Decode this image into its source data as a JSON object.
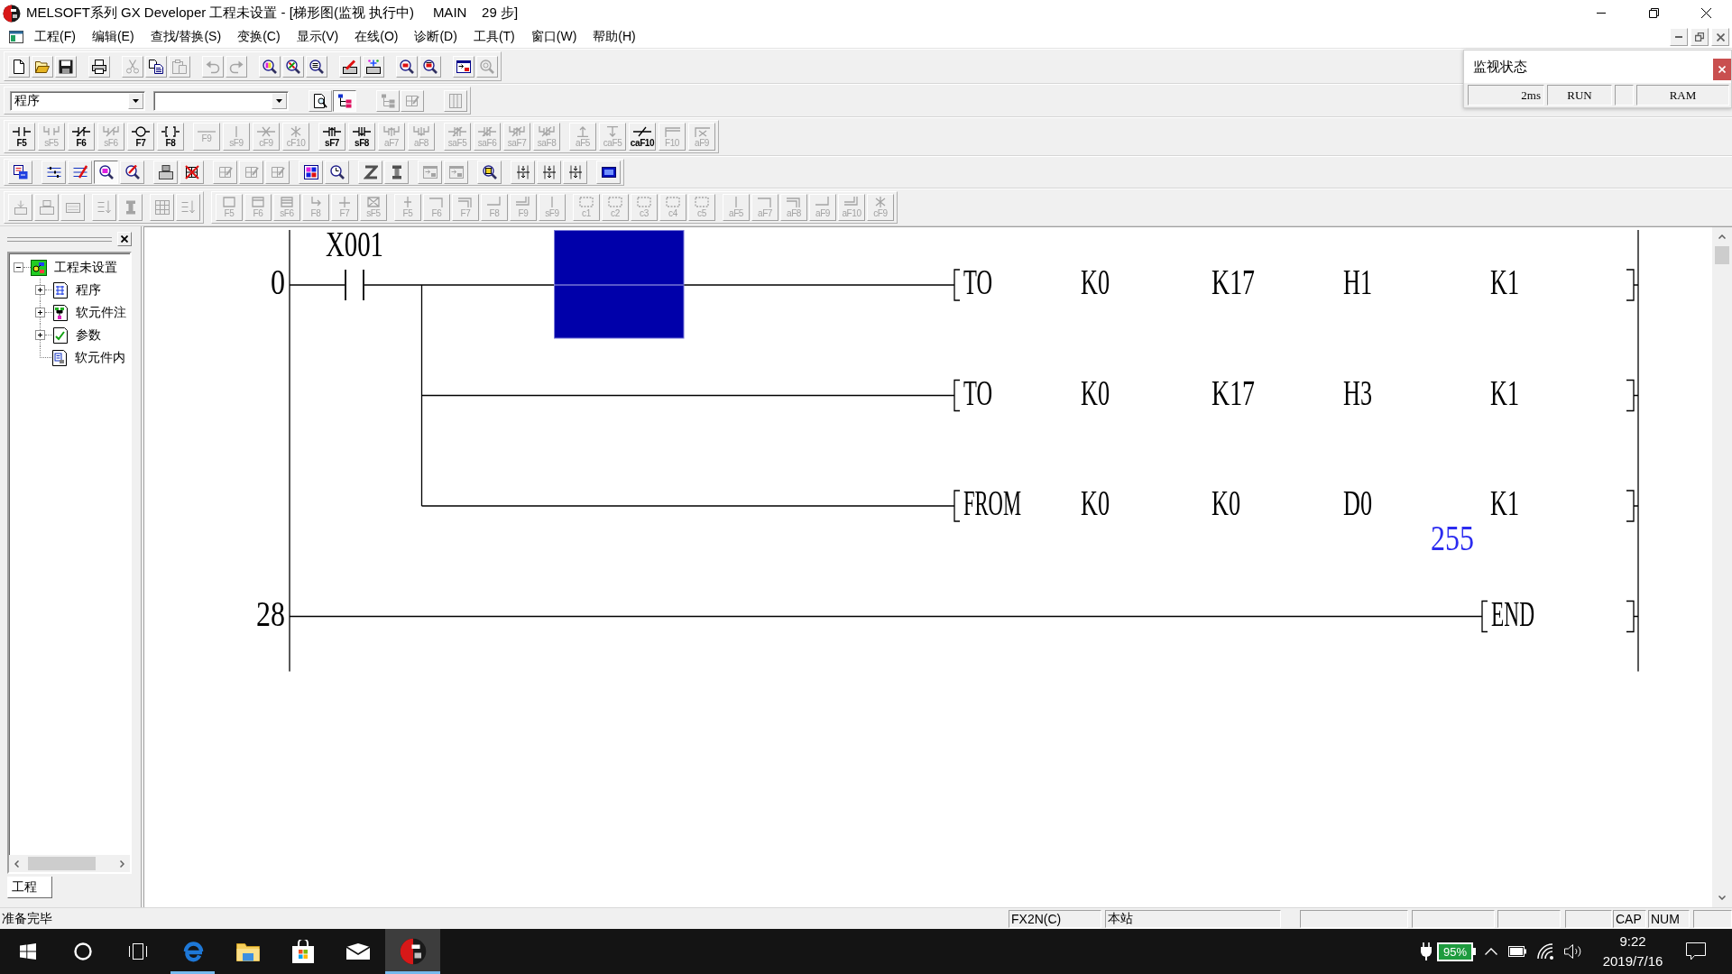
{
  "window": {
    "title": "MELSOFT系列 GX Developer 工程未设置 - [梯形图(监视 执行中)     MAIN    29 步]"
  },
  "menu": [
    "工程(F)",
    "编辑(E)",
    "查找/替换(S)",
    "变换(C)",
    "显示(V)",
    "在线(O)",
    "诊断(D)",
    "工具(T)",
    "窗口(W)",
    "帮助(H)"
  ],
  "toolbar_rows": [
    {
      "strips": [
        [
          [
            {
              "kind": "new",
              "disabled": false
            },
            {
              "kind": "open",
              "disabled": false
            },
            {
              "kind": "save",
              "disabled": false
            }
          ],
          [
            {
              "kind": "print",
              "disabled": false
            }
          ],
          [
            {
              "kind": "cut",
              "disabled": true
            },
            {
              "kind": "copy",
              "disabled": false
            },
            {
              "kind": "paste",
              "disabled": true
            }
          ],
          [
            {
              "kind": "undo",
              "disabled": true
            },
            {
              "kind": "redo",
              "disabled": true
            }
          ],
          [
            {
              "kind": "find-device",
              "disabled": false
            },
            {
              "kind": "find-instruction",
              "disabled": false
            },
            {
              "kind": "find-step",
              "disabled": false
            }
          ],
          [
            {
              "kind": "write",
              "disabled": false
            },
            {
              "kind": "read",
              "disabled": false
            }
          ],
          [
            {
              "kind": "find-box",
              "disabled": false
            },
            {
              "kind": "find-box-arrow",
              "disabled": false
            }
          ],
          [
            {
              "kind": "window-arrow",
              "disabled": false
            },
            {
              "kind": "find-gear",
              "disabled": true
            }
          ]
        ]
      ]
    },
    {
      "program_select": "程序",
      "strips": [
        [
          [
            {
              "kind": "page-magnifier",
              "disabled": false,
              "pressed": false
            },
            {
              "kind": "hierarchy",
              "disabled": false,
              "pressed": true
            }
          ],
          [
            {
              "kind": "hierarchy",
              "disabled": true,
              "pressed": false
            },
            {
              "kind": "grid-pencil",
              "disabled": true,
              "pressed": false
            }
          ],
          [
            {
              "kind": "columns",
              "disabled": true,
              "pressed": false
            }
          ]
        ]
      ]
    },
    {
      "strips": [
        [
          [
            {
              "kind": "contact",
              "key": "F5",
              "disabled": false
            },
            {
              "kind": "parallel-contact",
              "key": "sF5",
              "disabled": true
            },
            {
              "kind": "closed-contact",
              "key": "F6",
              "disabled": false
            },
            {
              "kind": "parallel-closed-contact",
              "key": "sF6",
              "disabled": true
            },
            {
              "kind": "coil",
              "key": "F7",
              "disabled": false
            },
            {
              "kind": "brace",
              "key": "F8",
              "disabled": false
            }
          ],
          [
            {
              "kind": "hline",
              "key": "F9",
              "disabled": true
            },
            {
              "kind": "vline",
              "key": "sF9",
              "disabled": true
            },
            {
              "kind": "hline-delete",
              "key": "cF9",
              "disabled": true
            },
            {
              "kind": "vline-delete",
              "key": "cF10",
              "disabled": true
            }
          ],
          [
            {
              "kind": "rising-contact",
              "key": "sF7",
              "disabled": false
            },
            {
              "kind": "falling-contact",
              "key": "sF8",
              "disabled": false
            },
            {
              "kind": "parallel-rising-contact",
              "key": "aF7",
              "disabled": true
            },
            {
              "kind": "parallel-falling-contact",
              "key": "aF8",
              "disabled": true
            }
          ],
          [
            {
              "kind": "rising-closed-contact",
              "key": "saF5",
              "disabled": true
            },
            {
              "kind": "falling-closed-contact",
              "key": "saF6",
              "disabled": true
            },
            {
              "kind": "parallel-rising-closed-contact",
              "key": "saF7",
              "disabled": true
            },
            {
              "kind": "parallel-falling-closed-contact",
              "key": "saF8",
              "disabled": true
            }
          ],
          [
            {
              "kind": "arrow-up",
              "key": "aF5",
              "disabled": true
            },
            {
              "kind": "arrow-down",
              "key": "caF5",
              "disabled": true
            },
            {
              "kind": "invert",
              "key": "caF10",
              "disabled": false
            },
            {
              "kind": "line-draw",
              "key": "F10",
              "disabled": true
            },
            {
              "kind": "line-delete",
              "key": "aF9",
              "disabled": true
            }
          ]
        ]
      ]
    },
    {
      "strips": [
        [
          [
            {
              "kind": "convert",
              "disabled": false,
              "pressed": false
            }
          ],
          [
            {
              "kind": "list",
              "disabled": false,
              "pressed": false
            },
            {
              "kind": "list-pencil",
              "disabled": false,
              "pressed": false
            },
            {
              "kind": "find-pink",
              "disabled": false,
              "pressed": true
            },
            {
              "kind": "find-pencil",
              "disabled": false,
              "pressed": false
            }
          ],
          [
            {
              "kind": "stamp",
              "disabled": false,
              "pressed": false
            },
            {
              "kind": "crossed-grid",
              "disabled": false,
              "pressed": false
            }
          ],
          [
            {
              "kind": "grid-pencil",
              "disabled": true,
              "pressed": false
            },
            {
              "kind": "grid-pencil",
              "disabled": true,
              "pressed": false
            },
            {
              "kind": "grid-pencil",
              "disabled": true,
              "pressed": false
            }
          ],
          [
            {
              "kind": "color-grid",
              "disabled": false,
              "pressed": false
            },
            {
              "kind": "find-clock",
              "disabled": false,
              "pressed": false
            }
          ],
          [
            {
              "kind": "z-shape",
              "disabled": false,
              "pressed": false
            },
            {
              "kind": "bar",
              "disabled": false,
              "pressed": false
            }
          ],
          [
            {
              "kind": "window-arrow",
              "disabled": true,
              "pressed": false
            },
            {
              "kind": "window-arrow",
              "disabled": true,
              "pressed": false
            }
          ],
          [
            {
              "kind": "find-yellow",
              "disabled": false,
              "pressed": false
            }
          ],
          [
            {
              "kind": "spacing",
              "disabled": false,
              "pressed": false
            },
            {
              "kind": "spacing",
              "disabled": false,
              "pressed": false
            },
            {
              "kind": "spacing",
              "disabled": false,
              "pressed": false
            }
          ],
          [
            {
              "kind": "monitor",
              "disabled": false,
              "pressed": false
            }
          ]
        ]
      ]
    },
    {
      "strips": [
        [
          [
            {
              "kind": "tray-arrow",
              "disabled": true
            },
            {
              "kind": "stamp",
              "disabled": true
            },
            {
              "kind": "label-box",
              "disabled": true
            }
          ],
          [
            {
              "kind": "sort",
              "disabled": true
            },
            {
              "kind": "bar",
              "disabled": true
            }
          ],
          [
            {
              "kind": "grid",
              "disabled": true
            },
            {
              "kind": "sort",
              "disabled": true
            }
          ]
        ],
        [
          [
            {
              "kind": "step",
              "key": "F5",
              "disabled": true
            },
            {
              "kind": "initial-step",
              "key": "F6",
              "disabled": true
            },
            {
              "kind": "block-step",
              "key": "sF6",
              "disabled": true
            },
            {
              "kind": "jump",
              "key": "F8",
              "disabled": true
            },
            {
              "kind": "transition",
              "key": "F7",
              "disabled": true
            },
            {
              "kind": "end-step",
              "key": "sF5",
              "disabled": true
            }
          ],
          [
            {
              "kind": "cross",
              "key": "F5",
              "disabled": true
            },
            {
              "kind": "branch-open",
              "key": "F6",
              "disabled": true
            },
            {
              "kind": "double-branch-open",
              "key": "F7",
              "disabled": true
            },
            {
              "kind": "branch-close",
              "key": "F8",
              "disabled": true
            },
            {
              "kind": "double-branch-close",
              "key": "F9",
              "disabled": true
            },
            {
              "kind": "vline",
              "key": "sF9",
              "disabled": true
            }
          ],
          [
            {
              "kind": "dashed-box",
              "key": "c1",
              "disabled": true
            },
            {
              "kind": "dashed-box",
              "key": "c2",
              "disabled": true
            },
            {
              "kind": "dashed-box",
              "key": "c3",
              "disabled": true
            },
            {
              "kind": "dashed-box",
              "key": "c4",
              "disabled": true
            },
            {
              "kind": "dashed-box",
              "key": "c5",
              "disabled": true
            }
          ],
          [
            {
              "kind": "vline",
              "key": "aF5",
              "disabled": true
            },
            {
              "kind": "branch-open",
              "key": "aF7",
              "disabled": true
            },
            {
              "kind": "double-branch-open",
              "key": "aF8",
              "disabled": true
            },
            {
              "kind": "branch-close",
              "key": "aF9",
              "disabled": true
            },
            {
              "kind": "double-branch-close",
              "key": "aF10",
              "disabled": true
            },
            {
              "kind": "vline-delete",
              "key": "cF9",
              "disabled": true
            }
          ]
        ]
      ]
    }
  ],
  "project_panel": {
    "tree": {
      "label": "工程未设置",
      "kind": "project",
      "expanded": true,
      "children": [
        {
          "label": "程序",
          "kind": "program",
          "expanded": false
        },
        {
          "label": "软元件注",
          "kind": "comment",
          "expanded": false
        },
        {
          "label": "参数",
          "kind": "parameter",
          "expanded": false
        },
        {
          "label": "软元件内",
          "kind": "memory"
        }
      ]
    },
    "tabs": [
      {
        "label": "工程",
        "selected": true
      }
    ]
  },
  "ladder": {
    "rungs": [
      {
        "step": "0",
        "contact": "X001",
        "branches": [
          {
            "instruction": "TO",
            "operands": [
              {
                "device": "K0"
              },
              {
                "device": "K17"
              },
              {
                "device": "H1"
              },
              {
                "device": "K1"
              }
            ]
          },
          {
            "instruction": "TO",
            "operands": [
              {
                "device": "K0"
              },
              {
                "device": "K17"
              },
              {
                "device": "H3"
              },
              {
                "device": "K1"
              }
            ]
          },
          {
            "instruction": "FROM",
            "operands": [
              {
                "device": "K0"
              },
              {
                "device": "K0"
              },
              {
                "device": "D0",
                "value": "255"
              },
              {
                "device": "K1"
              }
            ]
          }
        ]
      },
      {
        "step": "28",
        "branches": [
          {
            "instruction": "END"
          }
        ]
      }
    ]
  },
  "monitor_status": {
    "title": "监视状态",
    "scan_time": "2ms",
    "cpu_status": "RUN",
    "memory": "RAM"
  },
  "status_bar": {
    "message": "准备完毕",
    "plc_type": "FX2N(C)",
    "station": "本站",
    "caps_lock": "CAP",
    "num_lock": "NUM"
  },
  "taskbar": {
    "apps": [
      {
        "kind": "start",
        "running": false,
        "selected": false
      },
      {
        "kind": "search",
        "running": false,
        "selected": false
      },
      {
        "kind": "task-view",
        "running": false,
        "selected": false
      },
      {
        "kind": "browser",
        "running": true,
        "selected": false
      },
      {
        "kind": "files",
        "running": false,
        "selected": false
      },
      {
        "kind": "store",
        "running": false,
        "selected": false
      },
      {
        "kind": "mail",
        "running": false,
        "selected": false
      },
      {
        "kind": "app",
        "running": true,
        "selected": true
      }
    ],
    "battery": "95%",
    "time": "9:22",
    "date": "2019/7/16"
  }
}
